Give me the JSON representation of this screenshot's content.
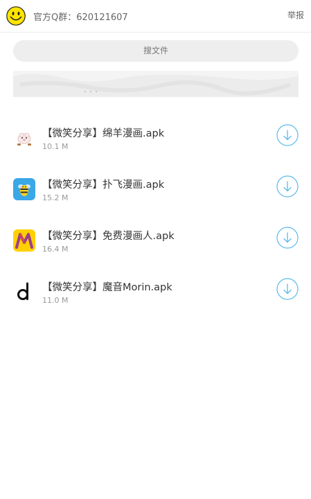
{
  "header": {
    "group_label": "官方Q群：620121607",
    "report_label": "举报"
  },
  "search": {
    "label": "搜文件"
  },
  "files": [
    {
      "name": "【微笑分享】绵羊漫画.apk",
      "size": "10.1 M",
      "icon": "sheep-app-icon"
    },
    {
      "name": "【微笑分享】扑飞漫画.apk",
      "size": "15.2 M",
      "icon": "bee-app-icon"
    },
    {
      "name": "【微笑分享】免费漫画人.apk",
      "size": "16.4 M",
      "icon": "m-letter-app-icon"
    },
    {
      "name": "【微笑分享】魔音Morin.apk",
      "size": "11.0 M",
      "icon": "d-letter-app-icon"
    }
  ],
  "colors": {
    "accent": "#5bb9ea",
    "logo_yellow": "#ffe400"
  }
}
